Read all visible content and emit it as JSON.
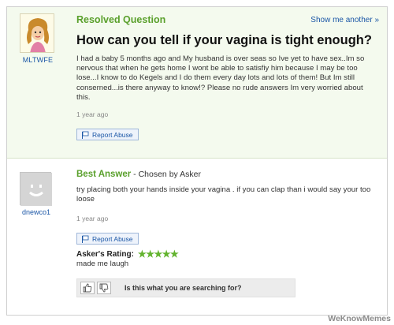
{
  "question": {
    "status_label": "Resolved Question",
    "show_more": "Show me another »",
    "asker": "MLTWFE",
    "title": "How can you tell if your vagina is tight enough?",
    "body": "I had a baby 5 months ago and My husband is over seas so Ive yet to have sex..Im so nervous that when he gets home I wont be able to satisfiy him because I may be too lose...I know to do Kegels and I do them every day lots and lots of them! But Im still conserned...is there anyway to know!? Please no rude answers Im very worried about this.",
    "time": "1 year ago",
    "report_label": "Report Abuse"
  },
  "answer": {
    "best_label": "Best Answer",
    "chosen_by": " - Chosen by Asker",
    "answerer": "dnewco1",
    "body": "try placing both your hands inside your vagina . if you can clap than i would say your too loose",
    "time": "1 year ago",
    "report_label": "Report Abuse",
    "rating_label": "Asker's Rating:",
    "stars": "★★★★★",
    "rating_value": 5,
    "rating_comment": "made me laugh",
    "feedback_question": "Is this what you are searching for?"
  },
  "colors": {
    "accent_green": "#5aa02c",
    "link_blue": "#1a56a6",
    "question_bg": "#f4faee"
  },
  "icons": {
    "report": "flag-icon",
    "thumbs_up": "thumbs-up-icon",
    "thumbs_down": "thumbs-down-icon",
    "default_avatar": "smiley-avatar-icon"
  },
  "watermark": "WeKnowMemes"
}
